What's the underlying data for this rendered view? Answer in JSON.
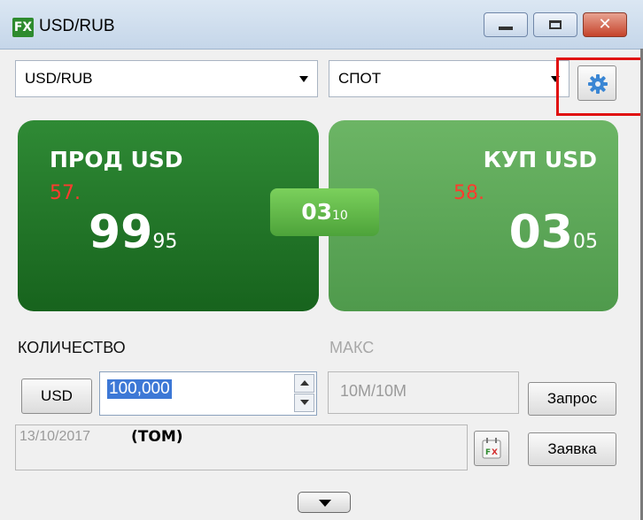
{
  "window": {
    "app_icon": "FX",
    "title": "USD/RUB",
    "controls": {
      "close_glyph": "✕"
    }
  },
  "selectors": {
    "pair": "USD/RUB",
    "type": "СПОТ",
    "settings_icon": "gear-icon"
  },
  "tiles": {
    "sell": {
      "label": "ПРОД USD",
      "big_figure": "57.",
      "pips": "99",
      "fraction": "95"
    },
    "buy": {
      "label": "КУП USD",
      "big_figure": "58.",
      "pips": "03",
      "fraction": "05"
    },
    "spread": {
      "pips": "03",
      "fraction": "10"
    }
  },
  "labels": {
    "quantity": "КОЛИЧЕСТВО",
    "max": "МАКС"
  },
  "quantity": {
    "currency_button": "USD",
    "value": "100,000"
  },
  "max": {
    "value": "10M/10M"
  },
  "buttons": {
    "request": "Запрос",
    "order": "Заявка"
  },
  "date": {
    "value": "13/10/2017",
    "tenor": "(TOM)"
  },
  "colors": {
    "sell_tile": "#1f7526",
    "buy_tile": "#5aa856",
    "spread": "#5fb845",
    "big_figure": "#ff3b2e",
    "highlight": "#e01010"
  }
}
